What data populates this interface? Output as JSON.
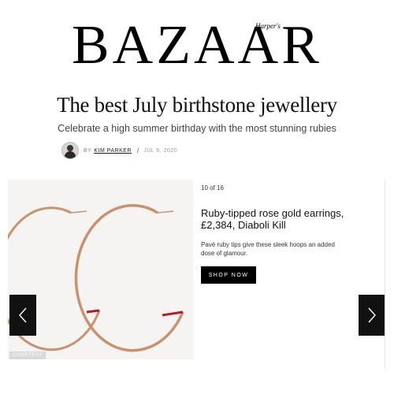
{
  "masthead": {
    "logo": "BAZAAR",
    "logo_prefix": "Harper's"
  },
  "article": {
    "headline": "The best July birthstone jewellery",
    "subheadline": "Celebrate a high summer birthday with the most stunning rubies",
    "byline": {
      "by": "BY",
      "author": "KIM PARKER",
      "separator": "/",
      "date": "JUL 6, 2020"
    }
  },
  "slideshow": {
    "counter": "10 of 16",
    "title": "Ruby-tipped rose gold earrings, £2,384, Diaboli Kill",
    "description": "Pavé ruby tips give these sleek hoops an added dose of glamour.",
    "shop_label": "SHOP NOW",
    "image_credit": "COURTESY",
    "icons": {
      "prev": "chevron-left-icon",
      "next": "chevron-right-icon"
    }
  },
  "colors": {
    "accent": "#c5221f",
    "hoop": "#c8926f",
    "button": "#000000"
  }
}
